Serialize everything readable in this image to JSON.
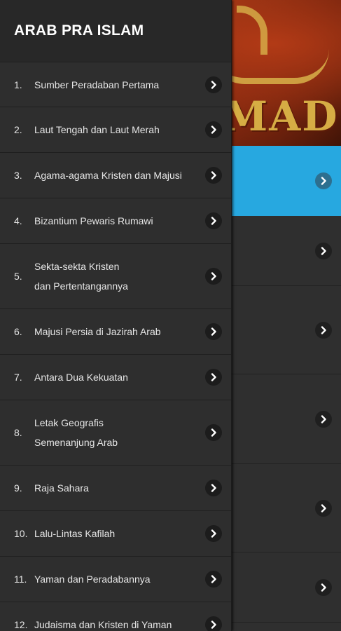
{
  "background": {
    "hero_text": "MAD",
    "accent_color": "#27a8e0",
    "rows": [
      {
        "active": true
      },
      {
        "active": false
      },
      {
        "active": false
      },
      {
        "active": false
      },
      {
        "active": false
      },
      {
        "active": false
      }
    ]
  },
  "drawer": {
    "title": "ARAB PRA ISLAM",
    "items": [
      {
        "num": "1.",
        "label": "Sumber Peradaban Pertama"
      },
      {
        "num": "2.",
        "label": "Laut Tengah dan Laut Merah"
      },
      {
        "num": "3.",
        "label": "Agama-agama Kristen dan Majusi"
      },
      {
        "num": "4.",
        "label": "Bizantium Pewaris Rumawi"
      },
      {
        "num": "5.",
        "label": "Sekta-sekta Kristen\ndan Pertentangannya"
      },
      {
        "num": "6.",
        "label": "Majusi Persia di Jazirah Arab"
      },
      {
        "num": "7.",
        "label": "Antara Dua Kekuatan"
      },
      {
        "num": "8.",
        "label": "Letak Geografis\nSemenanjung Arab"
      },
      {
        "num": "9.",
        "label": "Raja Sahara"
      },
      {
        "num": "10.",
        "label": "Lalu-Lintas Kafilah"
      },
      {
        "num": "11.",
        "label": "Yaman dan Peradabannya"
      },
      {
        "num": "12.",
        "label": "Judaisma dan Kristen di Yaman"
      }
    ]
  }
}
